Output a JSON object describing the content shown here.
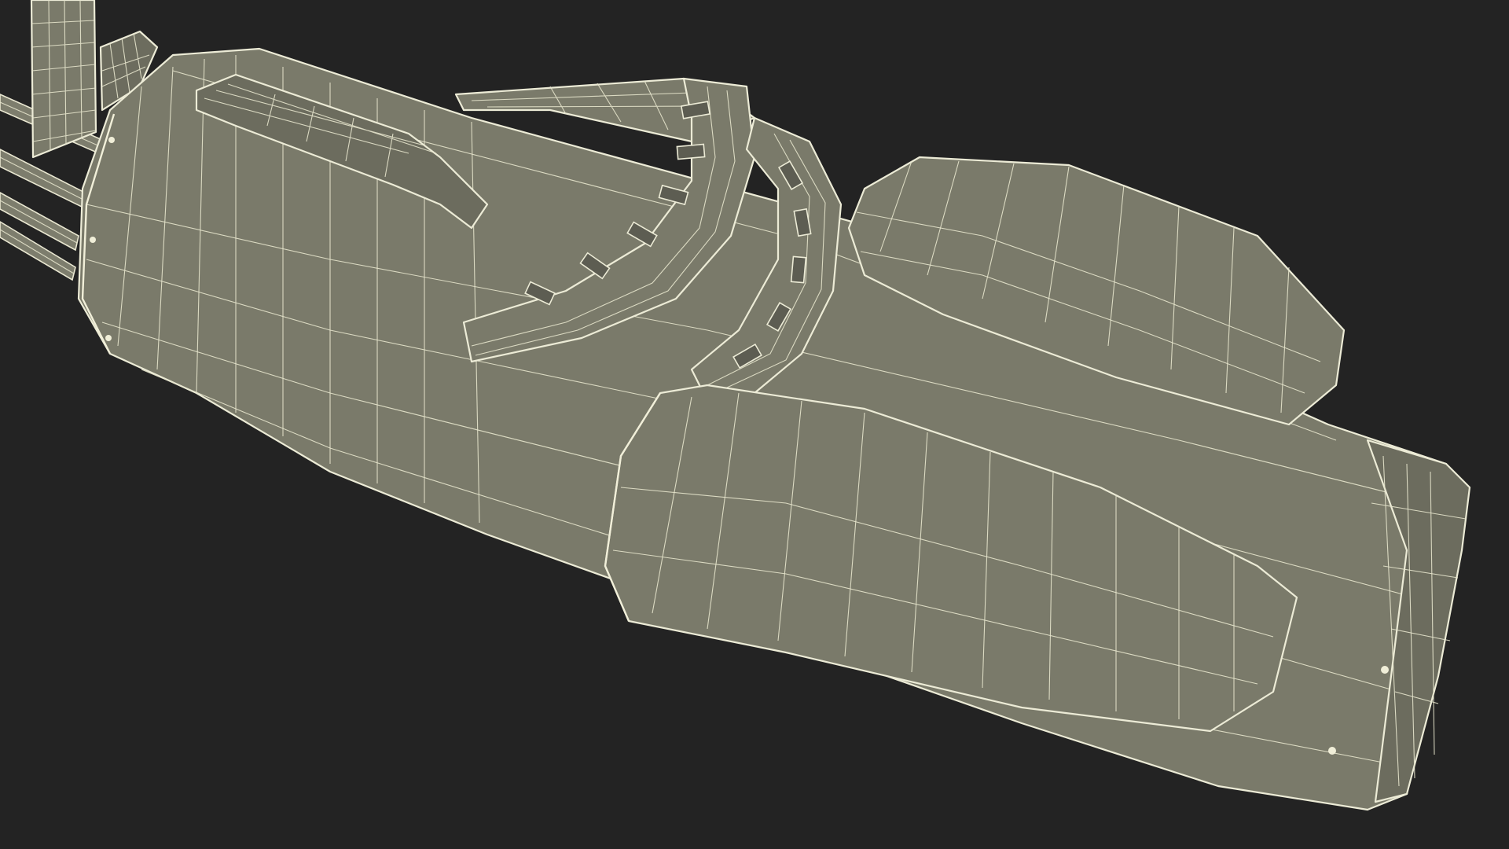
{
  "scene": {
    "subject": "golf-bag-wireframe-model",
    "background_color": "#232323",
    "mesh_fill_color": "#7a7a6a",
    "wire_color": "#ecebd6"
  }
}
